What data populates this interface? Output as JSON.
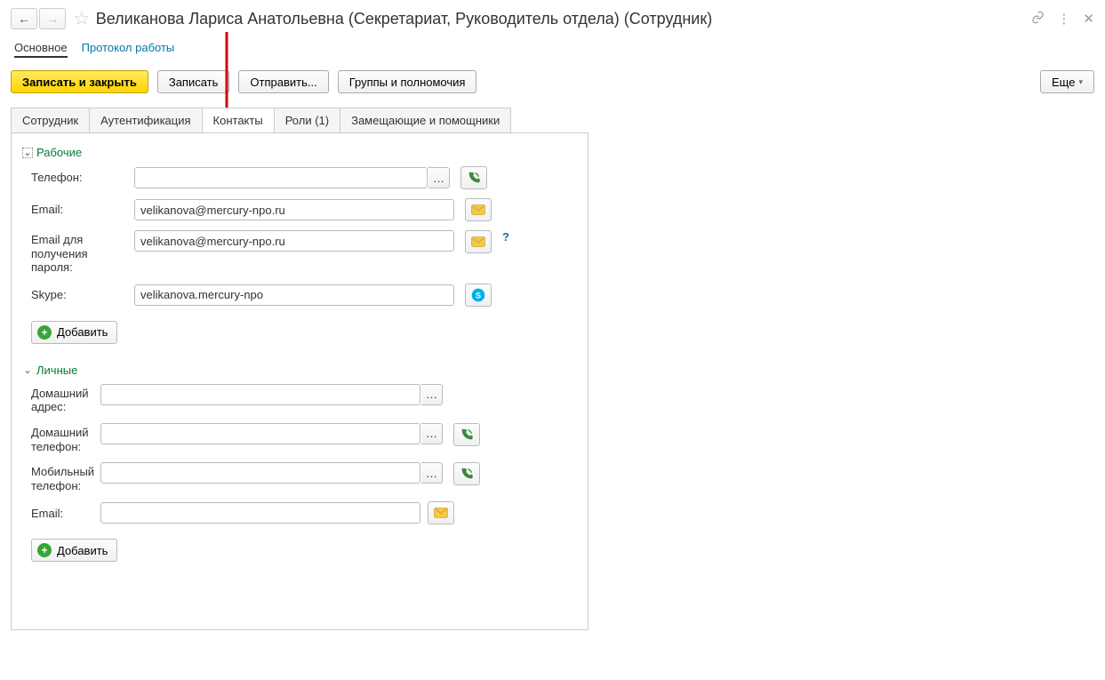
{
  "header": {
    "title": "Великанова Лариса Анатольевна (Секретариат, Руководитель отдела) (Сотрудник)"
  },
  "viewTabs": {
    "main": "Основное",
    "log": "Протокол работы"
  },
  "toolbar": {
    "saveClose": "Записать и закрыть",
    "save": "Записать",
    "send": "Отправить...",
    "groups": "Группы и полномочия",
    "more": "Еще"
  },
  "tabs": {
    "employee": "Сотрудник",
    "auth": "Аутентификация",
    "contacts": "Контакты",
    "roles": "Роли (1)",
    "substitutes": "Замещающие и помощники"
  },
  "work": {
    "header": "Рабочие",
    "phoneLabel": "Телефон:",
    "phone": "",
    "emailLabel": "Email:",
    "email": "velikanova@mercury-npo.ru",
    "pwdEmailLabel": "Email для получения пароля:",
    "pwdEmail": "velikanova@mercury-npo.ru",
    "skypeLabel": "Skype:",
    "skype": "velikanova.mercury-npo",
    "add": "Добавить"
  },
  "personal": {
    "header": "Личные",
    "homeAddrLabel": "Домашний адрес:",
    "homeAddr": "",
    "homePhoneLabel": "Домашний телефон:",
    "homePhone": "",
    "mobileLabel": "Мобильный телефон:",
    "mobile": "",
    "emailLabel": "Email:",
    "email": "",
    "add": "Добавить"
  }
}
